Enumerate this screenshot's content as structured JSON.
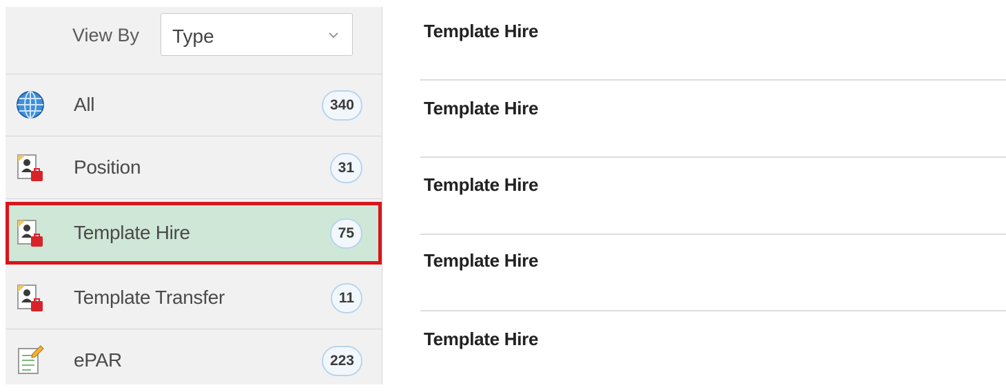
{
  "viewby": {
    "label": "View By",
    "selected": "Type"
  },
  "categories": [
    {
      "label": "All",
      "count": "340",
      "icon": "globe-icon",
      "selected": false
    },
    {
      "label": "Position",
      "count": "31",
      "icon": "person-document-icon",
      "selected": false
    },
    {
      "label": "Template Hire",
      "count": "75",
      "icon": "person-document-icon",
      "selected": true
    },
    {
      "label": "Template Transfer",
      "count": "11",
      "icon": "person-document-icon",
      "selected": false
    },
    {
      "label": "ePAR",
      "count": "223",
      "icon": "form-pencil-icon",
      "selected": false
    }
  ],
  "transactions": [
    {
      "title": "Template Hire"
    },
    {
      "title": "Template Hire"
    },
    {
      "title": "Template Hire"
    },
    {
      "title": "Template Hire"
    },
    {
      "title": "Template Hire"
    }
  ],
  "colors": {
    "selected_bg": "#cfe7d7",
    "highlight_border": "#d9141c",
    "badge_border": "#b8d4ee"
  }
}
